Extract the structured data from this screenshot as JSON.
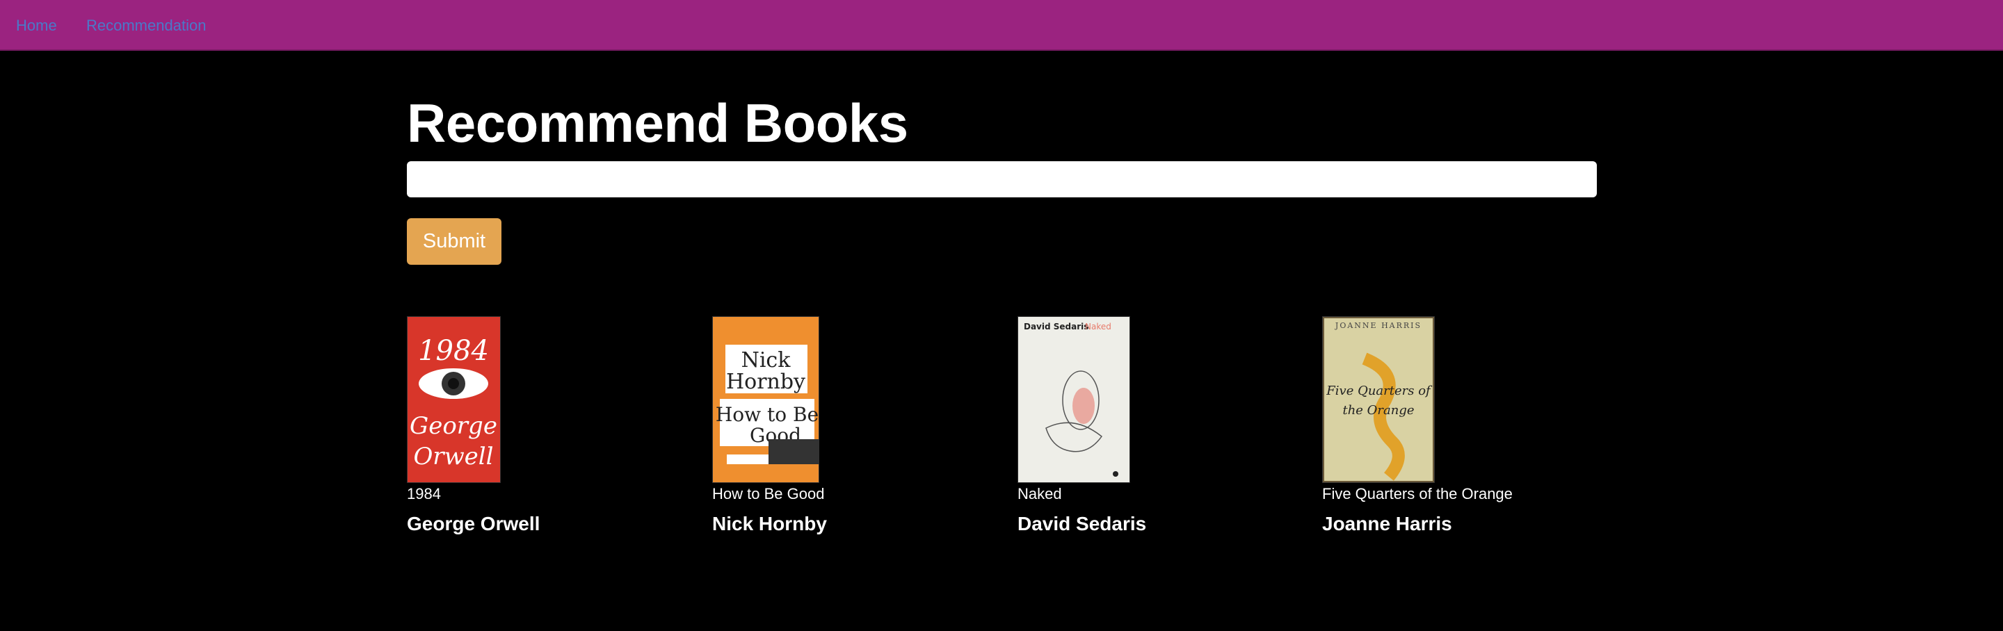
{
  "nav": {
    "home": "Home",
    "recommendation": "Recommendation"
  },
  "page": {
    "title": "Recommend Books"
  },
  "search": {
    "value": "",
    "placeholder": ""
  },
  "submit_label": "Submit",
  "colors": {
    "navbar": "#9b2380",
    "nav_link": "#4a79c9",
    "background": "#000000",
    "submit": "#e4a551"
  },
  "books": [
    {
      "title": "1984",
      "author": "George Orwell",
      "cover": {
        "color": "#d8362a",
        "big_text_1": "1984",
        "big_text_2": "George",
        "big_text_3": "Orwell"
      }
    },
    {
      "title": "How to Be Good",
      "author": "Nick Hornby",
      "cover": {
        "color": "#ef8f2f",
        "big_text_1": "Nick",
        "big_text_2": "Hornby",
        "big_text_3": "How to Be",
        "big_text_4": "Good"
      }
    },
    {
      "title": "Naked",
      "author": "David Sedaris",
      "cover": {
        "color": "#eeeee8",
        "header_1": "David Sedaris",
        "header_2": "Naked"
      }
    },
    {
      "title": "Five Quarters of the Orange",
      "author": "Joanne Harris",
      "cover": {
        "color": "#d9d2a3",
        "header": "JOANNE HARRIS",
        "big_text_1": "Five Quarters of",
        "big_text_2": "the Orange"
      }
    }
  ]
}
